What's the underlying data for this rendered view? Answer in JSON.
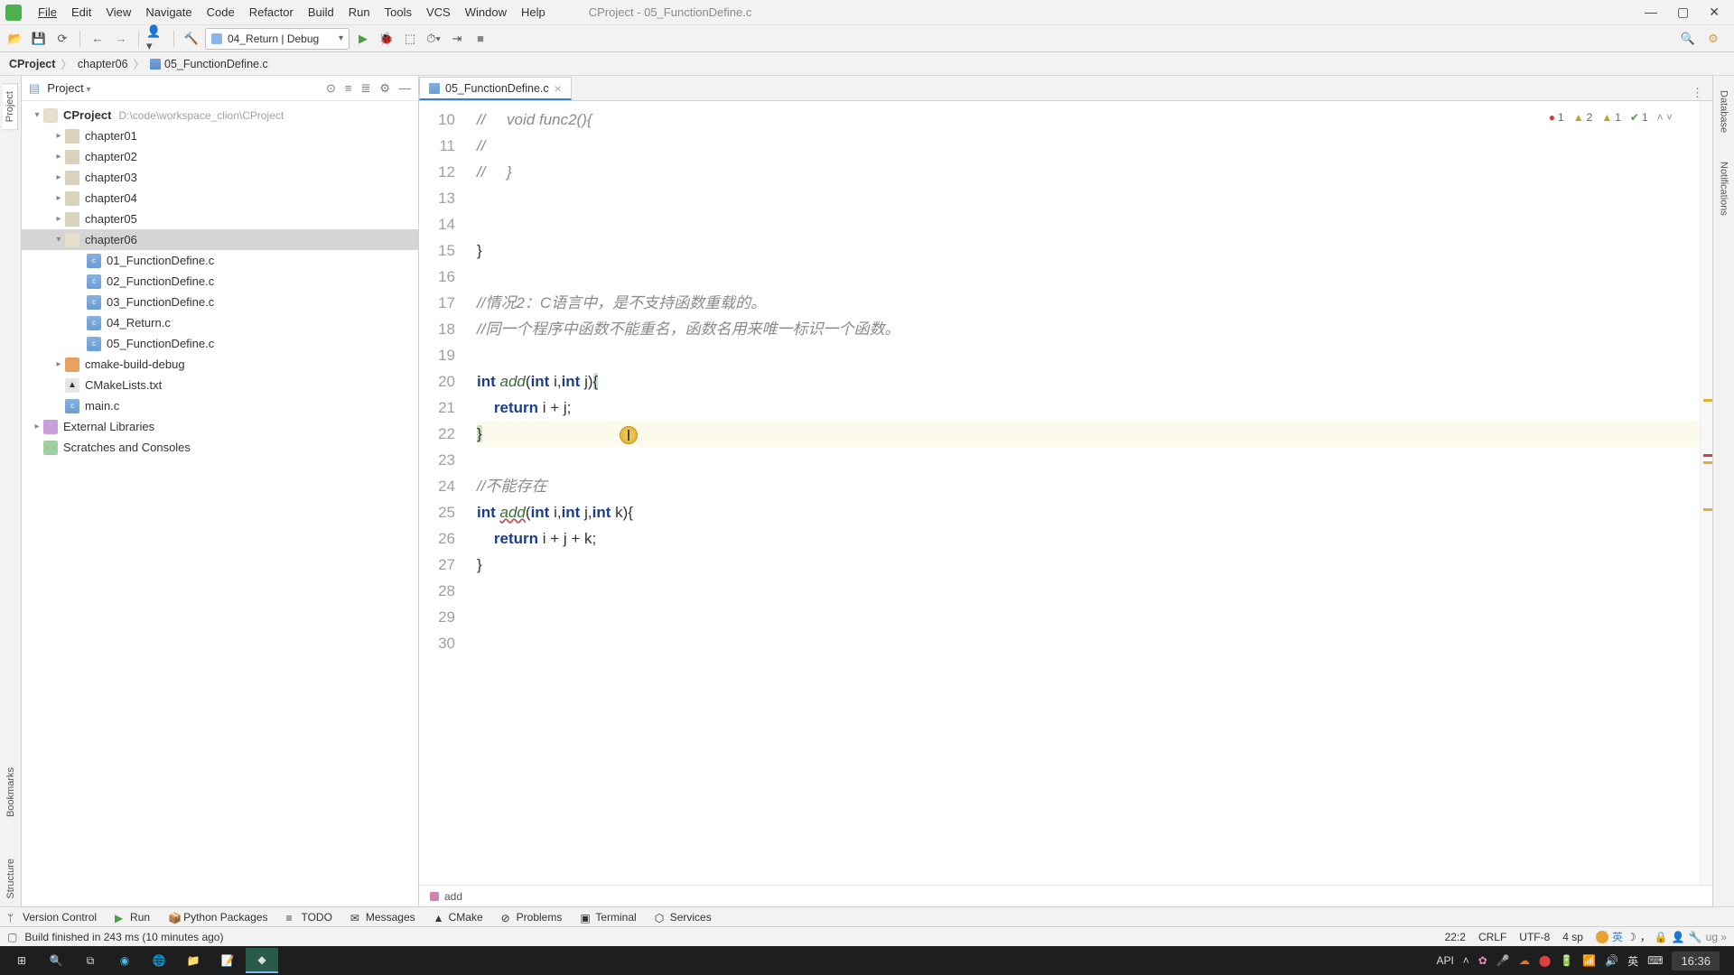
{
  "window_title": "CProject - 05_FunctionDefine.c",
  "menu": [
    "File",
    "Edit",
    "View",
    "Navigate",
    "Code",
    "Refactor",
    "Build",
    "Run",
    "Tools",
    "VCS",
    "Window",
    "Help"
  ],
  "run_config": "04_Return | Debug",
  "breadcrumb": {
    "root": "CProject",
    "folder": "chapter06",
    "file": "05_FunctionDefine.c"
  },
  "project_panel_title": "Project",
  "project_root": {
    "name": "CProject",
    "path": "D:\\code\\workspace_clion\\CProject"
  },
  "tree": {
    "chapters": [
      "chapter01",
      "chapter02",
      "chapter03",
      "chapter04",
      "chapter05",
      "chapter06"
    ],
    "ch06_files": [
      "01_FunctionDefine.c",
      "02_FunctionDefine.c",
      "03_FunctionDefine.c",
      "04_Return.c",
      "05_FunctionDefine.c"
    ],
    "build_folder": "cmake-build-debug",
    "cmake": "CMakeLists.txt",
    "main": "main.c",
    "ext_lib": "External Libraries",
    "scratch": "Scratches and Consoles"
  },
  "editor_tab": "05_FunctionDefine.c",
  "line_start": 10,
  "code_lines": [
    {
      "t": "//     void func2(){",
      "cls": "cmt"
    },
    {
      "t": "//",
      "cls": "cmt"
    },
    {
      "t": "//     }",
      "cls": "cmt"
    },
    {
      "t": "",
      "cls": ""
    },
    {
      "t": "",
      "cls": ""
    },
    {
      "t": "}",
      "cls": ""
    },
    {
      "t": "",
      "cls": ""
    },
    {
      "t": "//情况2：C语言中，是不支持函数重载的。",
      "cls": "cmt"
    },
    {
      "t": "//同一个程序中函数不能重名，函数名用来唯一标识一个函数。",
      "cls": "cmt"
    },
    {
      "t": "",
      "cls": ""
    },
    {
      "t": "int add(int i,int j){",
      "cls": "sig1"
    },
    {
      "t": "    return i + j;",
      "cls": "ret"
    },
    {
      "t": "}",
      "cls": "hl"
    },
    {
      "t": "",
      "cls": ""
    },
    {
      "t": "//不能存在",
      "cls": "cmt"
    },
    {
      "t": "int add(int i,int j,int k){",
      "cls": "sig2"
    },
    {
      "t": "    return i + j + k;",
      "cls": "ret"
    },
    {
      "t": "}",
      "cls": ""
    },
    {
      "t": "",
      "cls": ""
    },
    {
      "t": "",
      "cls": ""
    },
    {
      "t": "",
      "cls": ""
    }
  ],
  "inspections": {
    "errors": "1",
    "warnings": "2",
    "weak": "1",
    "typos": "1"
  },
  "crumb_func": "add",
  "toolwin": [
    "Version Control",
    "Run",
    "Python Packages",
    "TODO",
    "Messages",
    "CMake",
    "Problems",
    "Terminal",
    "Services"
  ],
  "status_msg": "Build finished in 243 ms (10 minutes ago)",
  "status_right": {
    "pos": "22:2",
    "eol": "CRLF",
    "enc": "UTF-8",
    "indent": "4 sp",
    "ime": "英",
    "api": "API"
  },
  "taskbar_clock": "16:36",
  "right_tabs": [
    "Database",
    "Notifications"
  ],
  "left_tabs": [
    "Project",
    "Bookmarks",
    "Structure"
  ]
}
